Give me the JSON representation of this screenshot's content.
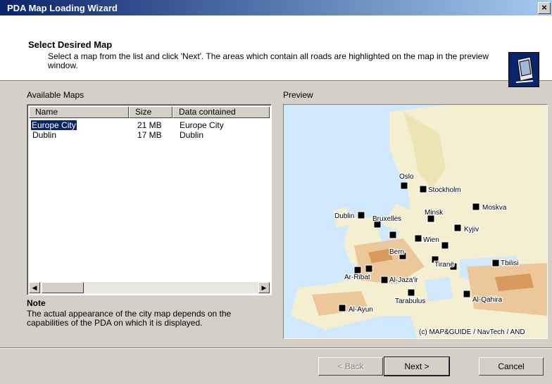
{
  "window": {
    "title": "PDA Map Loading Wizard",
    "close_label": "×"
  },
  "header": {
    "title": "Select Desired Map",
    "description": "Select a map from the list and click 'Next'. The areas which contain all roads are highlighted on the map in the preview window.",
    "icon": "pda-icon"
  },
  "maps": {
    "label": "Available Maps",
    "columns": [
      "Name",
      "Size",
      "Data contained"
    ],
    "rows": [
      {
        "name": "Europe City",
        "size": "21 MB",
        "data": "Europe City",
        "selected": true
      },
      {
        "name": "Dublin",
        "size": "17 MB",
        "data": "Dublin",
        "selected": false
      }
    ]
  },
  "note": {
    "title": "Note",
    "body": "The actual appearance of the city map depends on the capabilities of the PDA on which it is displayed."
  },
  "preview": {
    "label": "Preview",
    "copyright": "(c) MAP&GUIDE / NavTech / AND",
    "cities": [
      "Oslo",
      "Stockholm",
      "Moskva",
      "Dublin",
      "Bruxelles",
      "Minsk",
      "Kyjiv",
      "Wien",
      "Bern",
      "Tiranë",
      "Tbilisi",
      "Ar-Ribat",
      "Al-Jaza'ir",
      "Tarabulus",
      "Al-Qahira",
      "Al-Ayun"
    ]
  },
  "buttons": {
    "back": "< Back",
    "next": "Next >",
    "cancel": "Cancel"
  },
  "colors": {
    "titlebar_start": "#0a246a",
    "titlebar_end": "#a6caf0",
    "selection": "#0a246a",
    "face": "#d4d0c8"
  }
}
